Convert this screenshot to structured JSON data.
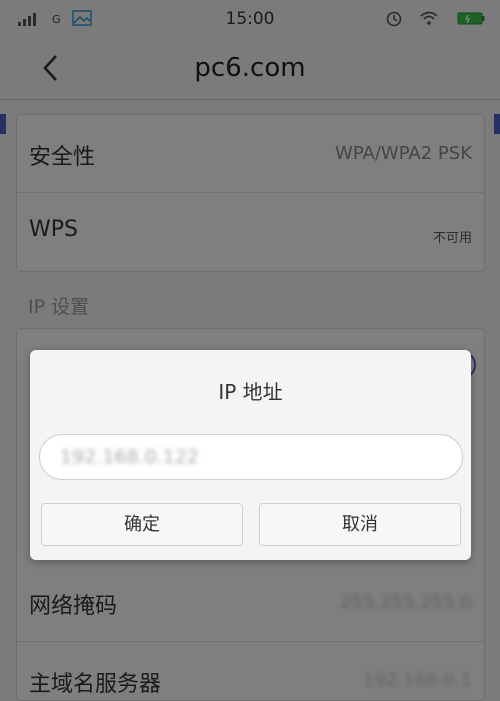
{
  "statusbar": {
    "network": "G",
    "time": "15:00"
  },
  "header": {
    "title": "pc6.com"
  },
  "settings": {
    "security_label": "安全性",
    "security_value": "WPA/WPA2 PSK",
    "wps_label": "WPS",
    "wps_value": "不可用",
    "ip_section": "IP 设置",
    "netmask_label": "网络掩码",
    "netmask_value": "255.255.255.0",
    "dns_label": "主域名服务器",
    "dns_value": "192.168.0.1"
  },
  "dialog": {
    "title": "IP 地址",
    "ip_value": "192.168.0.122",
    "confirm_label": "确定",
    "cancel_label": "取消"
  },
  "colors": {
    "accent": "#4b63c8",
    "battery": "#37c24a"
  }
}
